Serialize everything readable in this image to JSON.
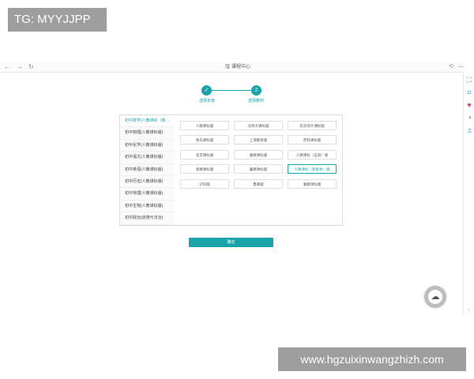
{
  "watermark": {
    "top": "TG: MYYJJPP",
    "bottom": "www.hgzuixinwangzhizh.com"
  },
  "window": {
    "title": "课程中心",
    "nav": {
      "back": "←",
      "forward": "→",
      "refresh": "↻"
    },
    "controls": {
      "pin": "⟲",
      "minimize": "—"
    }
  },
  "right_rail": {
    "icons": [
      "expand-icon",
      "scan-icon",
      "heart-icon",
      "history-icon",
      "music-icon"
    ],
    "glyphs": [
      "⛶",
      "⌗",
      "♥",
      "◔",
      "♫"
    ],
    "bottom_glyph": "›"
  },
  "stepper": {
    "steps": [
      {
        "symbol": "✓",
        "label": "选择年级"
      },
      {
        "symbol": "2",
        "label": "选择教材"
      }
    ]
  },
  "subjects": [
    "初中数学(人教课标（新…",
    "初中物理(人教课标版)",
    "初中化学(人教课标版)",
    "初中语文(人教课标版)",
    "初中英语(人教课标版)",
    "初中历史(人教课标版)",
    "初中地理(人教课标版)",
    "初中生物(人教课标版)",
    "初中政治(道德与法治)"
  ],
  "editions": [
    [
      "人教课标版",
      "北师大课标版",
      "华东师大课标版"
    ],
    [
      "青岛课标版",
      "上海教育版",
      "苏科课标版"
    ],
    [
      "北京课标版",
      "湘教课标版",
      "人教课标（五四）版"
    ],
    [
      "浙教课标版",
      "冀教课标版",
      "人教课标（新版本）版"
    ],
    [
      "沪科版",
      "鲁教版",
      "湘教课标版"
    ]
  ],
  "selected_edition": "人教课标（新版本）版",
  "next_button": "确定",
  "colors": {
    "accent": "#1aa3a8",
    "rail_icon": "#1c8fd6",
    "watermark_bg": "#9e9e9e"
  }
}
